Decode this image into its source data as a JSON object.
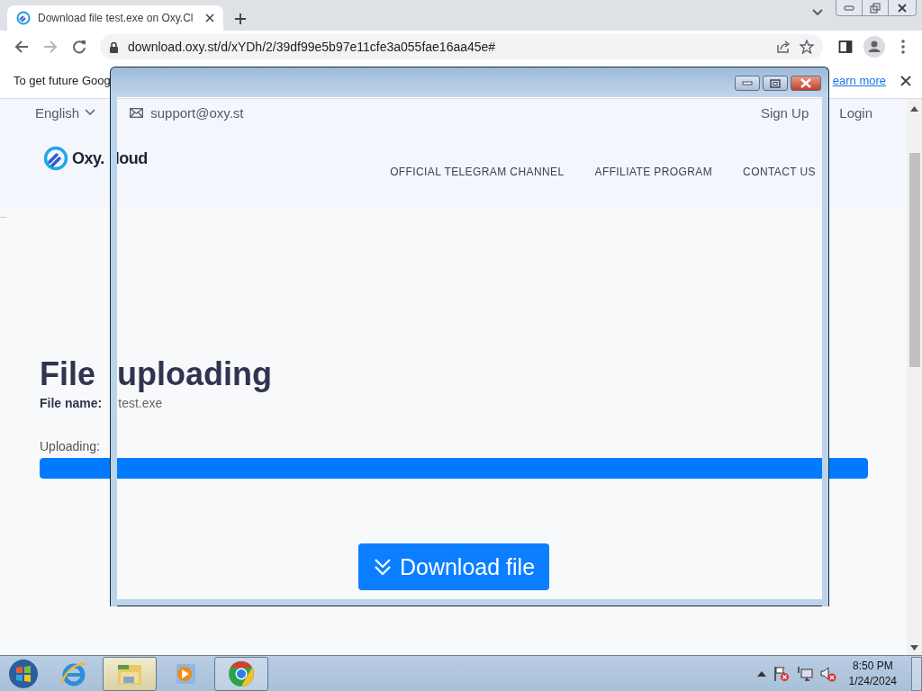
{
  "browser": {
    "tab": {
      "title": "Download file test.exe on Oxy.Cl",
      "selected": true
    },
    "address": "download.oxy.st/d/xYDh/2/39df99e5b97e11cfe3a055fae16aa45e#"
  },
  "infobar": {
    "text": "To get future Goog",
    "link": "earn more"
  },
  "page": {
    "language": "English",
    "support_email": "support@oxy.st",
    "auth_links": [
      "Sign Up",
      "Login"
    ],
    "logo": [
      "Oxy.",
      "loud"
    ],
    "nav": [
      "OFFICIAL TELEGRAM CHANNEL",
      "AFFILIATE PROGRAM",
      "CONTACT US"
    ],
    "ellipsis": "...",
    "title": "File uploading",
    "file_name_label": "File name:",
    "file_name": "test.exe",
    "progress_label": "Uploading:",
    "progress": {
      "level": 1
    },
    "download_button": "Download file"
  },
  "taskbar": {
    "apps": [
      {
        "kind": "ie",
        "running": false,
        "highlighted": false
      },
      {
        "kind": "explorer",
        "running": true,
        "highlighted": true
      },
      {
        "kind": "media",
        "running": false,
        "highlighted": false
      },
      {
        "kind": "chrome",
        "running": true,
        "highlighted": false
      }
    ],
    "time": "8:50 PM",
    "date": "1/24/2024"
  }
}
